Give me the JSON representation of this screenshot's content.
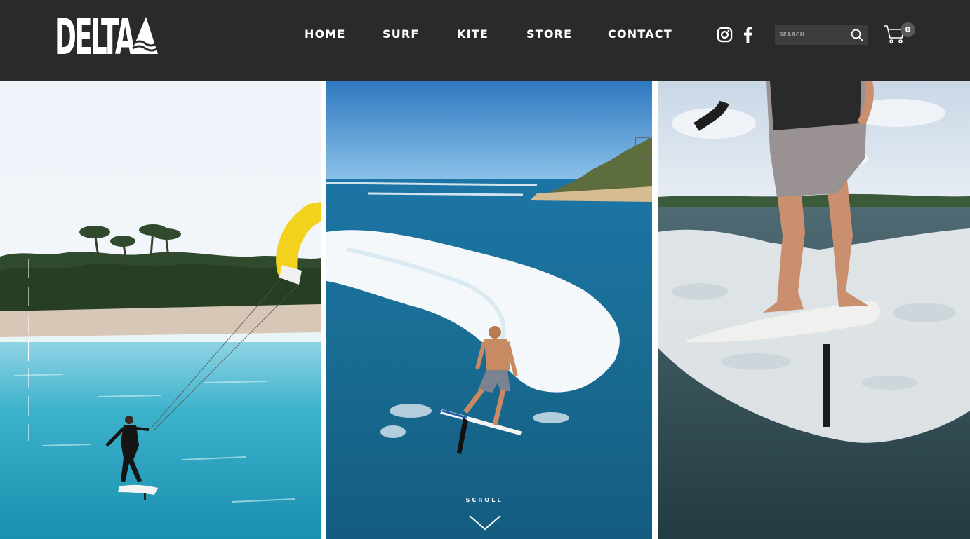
{
  "header": {
    "logo_text": "DELTA",
    "nav": [
      {
        "label": "HOME"
      },
      {
        "label": "SURF"
      },
      {
        "label": "KITE"
      },
      {
        "label": "STORE"
      },
      {
        "label": "CONTACT"
      }
    ],
    "social": [
      {
        "icon": "instagram-icon"
      },
      {
        "icon": "facebook-icon"
      }
    ],
    "search": {
      "placeholder": "SEARCH",
      "icon": "search-icon"
    },
    "cart": {
      "icon": "cart-icon",
      "count": "0"
    }
  },
  "hero": {
    "scroll_label": "SCROLL",
    "scroll_icon": "chevron-down-icon"
  },
  "colors": {
    "header_bg": "#2a2a2a",
    "text": "#ffffff",
    "search_bg": "#3d3d3d",
    "badge_bg": "#5a5a5a"
  }
}
